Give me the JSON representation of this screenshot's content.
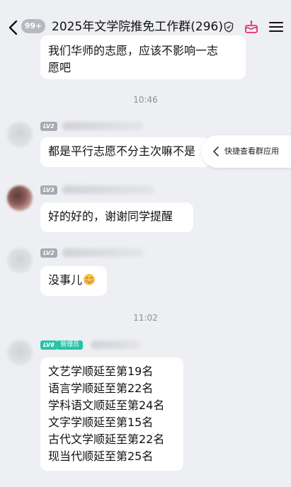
{
  "header": {
    "back_badge": "99+",
    "title": "2025年文学院推免工作群(296)"
  },
  "messages": [
    {
      "id": "m0",
      "text_lines": [
        "我们华师的志愿，应该不影响一志",
        "愿吧"
      ]
    },
    {
      "id": "t1",
      "time": "10:46"
    },
    {
      "id": "m1",
      "level": "LV2",
      "text": "都是平行志愿不分主次嘛不是"
    },
    {
      "id": "m2",
      "level": "LV3",
      "text": "好的好的，谢谢同学提醒"
    },
    {
      "id": "m3",
      "level": "LV2",
      "text": "没事儿"
    },
    {
      "id": "t2",
      "time": "11:02"
    },
    {
      "id": "m4",
      "level": "LV8",
      "role": "管理员",
      "text_lines": [
        "文艺学顺延至第19名",
        "语言学顺延至第22名",
        "学科语文顺延至第24名",
        "文字学顺延至第15名",
        "古代文学顺延至第22名",
        "现当代顺延至第25名"
      ]
    }
  ],
  "quick_panel": {
    "label": "快捷查看群应用"
  },
  "colors": {
    "background": "#eeeff3",
    "bubble": "#ffffff",
    "admin_badge": "#27c3a8",
    "level_badge": "#a8aab3"
  }
}
